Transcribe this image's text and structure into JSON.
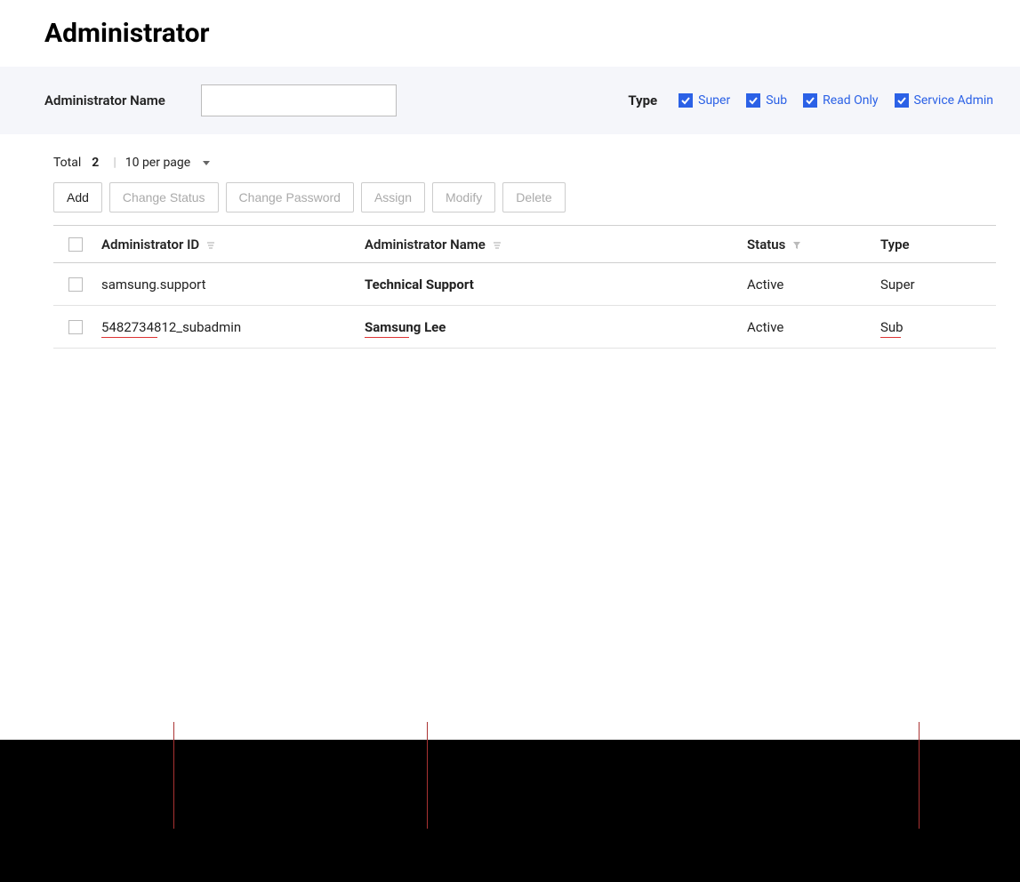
{
  "title": "Administrator",
  "filter": {
    "name_label": "Administrator Name",
    "name_value": "",
    "type_label": "Type",
    "types": [
      {
        "label": "Super",
        "checked": true
      },
      {
        "label": "Sub",
        "checked": true
      },
      {
        "label": "Read Only",
        "checked": true
      },
      {
        "label": "Service Admin",
        "checked": true
      }
    ]
  },
  "meta": {
    "total_label": "Total",
    "total_value": "2",
    "per_page": "10 per page"
  },
  "toolbar": {
    "add": "Add",
    "change_status": "Change Status",
    "change_password": "Change Password",
    "assign": "Assign",
    "modify": "Modify",
    "delete": "Delete"
  },
  "columns": {
    "id": "Administrator ID",
    "name": "Administrator Name",
    "status": "Status",
    "type": "Type"
  },
  "rows": [
    {
      "id": "samsung.support",
      "name": "Technical Support",
      "status": "Active",
      "type": "Super"
    },
    {
      "id": "5482734812_subadmin",
      "name": "Samsung Lee",
      "status": "Active",
      "type": "Sub"
    }
  ]
}
